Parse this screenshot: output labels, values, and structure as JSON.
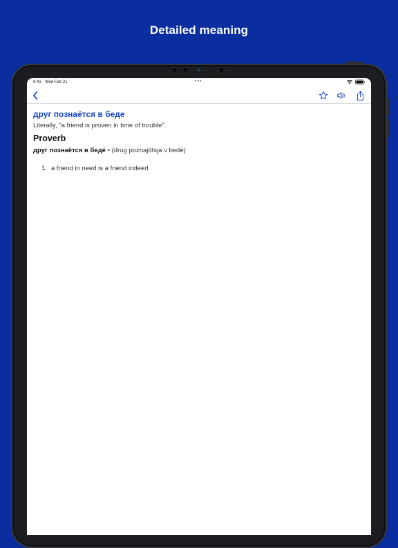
{
  "headline": "Detailed meaning",
  "status_bar": {
    "time": "9:41",
    "date": "Wed Feb 21",
    "dots": "•••"
  },
  "nav": {
    "back_icon": "chevron-left-icon",
    "favorite_icon": "star-icon",
    "audio_icon": "speaker-icon",
    "share_icon": "share-icon"
  },
  "entry": {
    "title": "друг познаётся в беде",
    "literal": "Literally, \"a friend is proven in time of trouble\".",
    "part_of_speech": "Proverb",
    "headword": "друг познаётся в беде́",
    "transliteration": " • (drug poznajótsja v bedé)",
    "definitions": [
      {
        "number": "1.",
        "text": "a friend in need is a friend indeed"
      }
    ]
  },
  "colors": {
    "background": "#0a2ea0",
    "accent": "#1a49c6"
  }
}
